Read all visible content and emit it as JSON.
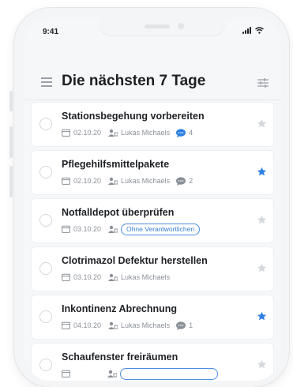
{
  "status_bar": {
    "time": "9:41"
  },
  "header": {
    "title": "Die nächsten 7 Tage"
  },
  "colors": {
    "accent": "#2f80e3",
    "star_inactive": "#d5d8dc",
    "comment_active": "#2f80e3",
    "comment_inactive": "#8b9097"
  },
  "tasks": [
    {
      "title": "Stationsbegehung vorbereiten",
      "date": "02.10.20",
      "assignee": "Lukas Michaels",
      "comments": "4",
      "comments_highlight": true,
      "starred": false
    },
    {
      "title": "Pflegehilfsmittelpakete",
      "date": "02.10.20",
      "assignee": "Lukas Michaels",
      "comments": "2",
      "comments_highlight": false,
      "starred": true
    },
    {
      "title": "Notfalldepot überprüfen",
      "date": "03.10.20",
      "assignee_badge": "Ohne Verantwortlichen",
      "starred": false
    },
    {
      "title": "Clotrimazol Defektur herstellen",
      "date": "03.10.20",
      "assignee": "Lukas Michaels",
      "starred": false
    },
    {
      "title": "Inkontinenz Abrechnung",
      "date": "04.10.20",
      "assignee": "Lukas Michaels",
      "comments": "1",
      "comments_highlight": false,
      "starred": true
    },
    {
      "title": "Schaufenster freiräumen",
      "date": "",
      "assignee_badge": "",
      "starred": false
    }
  ]
}
